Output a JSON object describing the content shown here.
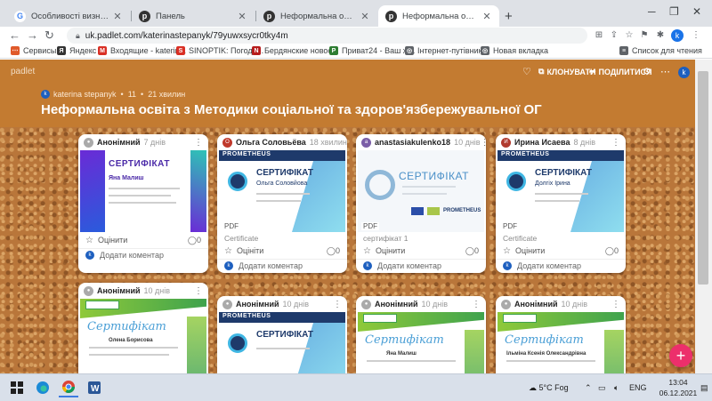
{
  "browser": {
    "tabs": [
      {
        "title": "Особливості визнання неформ",
        "favicon": "google-icon",
        "active": false
      },
      {
        "title": "Панель",
        "favicon": "padlet-icon",
        "active": false
      },
      {
        "title": "Неформальна освіта з Методи",
        "favicon": "padlet-icon",
        "active": false
      },
      {
        "title": "Неформальна освіта з Методи",
        "favicon": "padlet-icon",
        "active": true
      }
    ],
    "new_tab": "+",
    "url": "uk.padlet.com/katerinastepanyk/79yuwxsycr0tky4m",
    "profile_initial": "k",
    "bookmarks": [
      {
        "label": "Сервисы",
        "icon": "apps-icon",
        "color": "#e05a2b"
      },
      {
        "label": "Яндекс",
        "icon": "yandex-icon",
        "color": "#333333"
      },
      {
        "label": "Входящие - katerin...",
        "icon": "gmail-icon",
        "color": "#d93025"
      },
      {
        "label": "SINOPTIK: Погода...",
        "icon": "weather-icon",
        "color": "#d93025"
      },
      {
        "label": "Бердянские новос...",
        "icon": "news-icon",
        "color": "#b71c1c"
      },
      {
        "label": "Приват24 - Ваш ж...",
        "icon": "privat-icon",
        "color": "#2e7d32"
      },
      {
        "label": "Інтернет-путівник...",
        "icon": "globe-icon",
        "color": "#5f6368"
      },
      {
        "label": "Новая вкладка",
        "icon": "globe-icon",
        "color": "#5f6368"
      }
    ],
    "reading_list": "Список для чтения"
  },
  "padlet": {
    "brand": "padlet",
    "clone_label": "КЛОНУВАТИ",
    "share_label": "ПОДІЛИТИСЯ",
    "author": "katerina stepanyk",
    "likes": "11",
    "time": "21 хвилин",
    "title": "Неформальна освіта з Методики соціальної та здоров'язбережувальної ОГ",
    "colors": {
      "background": "#c37b31",
      "accent": "#ec2f6b"
    }
  },
  "cards": [
    {
      "author": "Анонімний",
      "time": "7 днів",
      "cert_title": "СЕРТИФІКАТ",
      "cert_name": "Яна Малиш",
      "pdf": "",
      "caption": "",
      "rate": "Оцінити",
      "add_comment": "Додати коментар"
    },
    {
      "author": "Ольга Соловьёва",
      "time": "18 хвилин",
      "cert_title": "СЕРТИФІКАТ",
      "cert_name": "Ольга Соловйова",
      "pdf": "PDF",
      "caption": "Certificate",
      "rate": "Оцініти",
      "add_comment": "Додати коментар"
    },
    {
      "author": "anastasiakulenko18",
      "time": "10 днів",
      "cert_title": "СЕРТИФІКАТ",
      "cert_name": "PROMETHEUS",
      "pdf": "PDF",
      "caption": "сертифікат 1",
      "rate": "Оцінити",
      "add_comment": "Додати коментар"
    },
    {
      "author": "Ирина Исаева",
      "time": "8 днів",
      "cert_title": "СЕРТИФІКАТ",
      "cert_name": "Долгіх Ірина",
      "pdf": "PDF",
      "caption": "Certificate",
      "rate": "Оцінити",
      "add_comment": "Додати коментар"
    },
    {
      "author": "Анонімний",
      "time": "10 днів",
      "cert_title": "Сертифікат",
      "cert_name": "Олена Борисова"
    },
    {
      "author": "Анонімний",
      "time": "10 днів",
      "cert_title": "СЕРТИФІКАТ",
      "cert_name": "PROMETHEUS"
    },
    {
      "author": "Анонімний",
      "time": "10 днів",
      "cert_title": "Сертифікат",
      "cert_name": "Яна Малиш"
    },
    {
      "author": "Анонімний",
      "time": "10 днів",
      "cert_title": "Сертифікат",
      "cert_name": "Ільміна Ксенія Олександрівна"
    }
  ],
  "taskbar": {
    "weather": "5°C  Fog",
    "lang": "ENG",
    "time": "13:04",
    "date": "06.12.2021"
  }
}
